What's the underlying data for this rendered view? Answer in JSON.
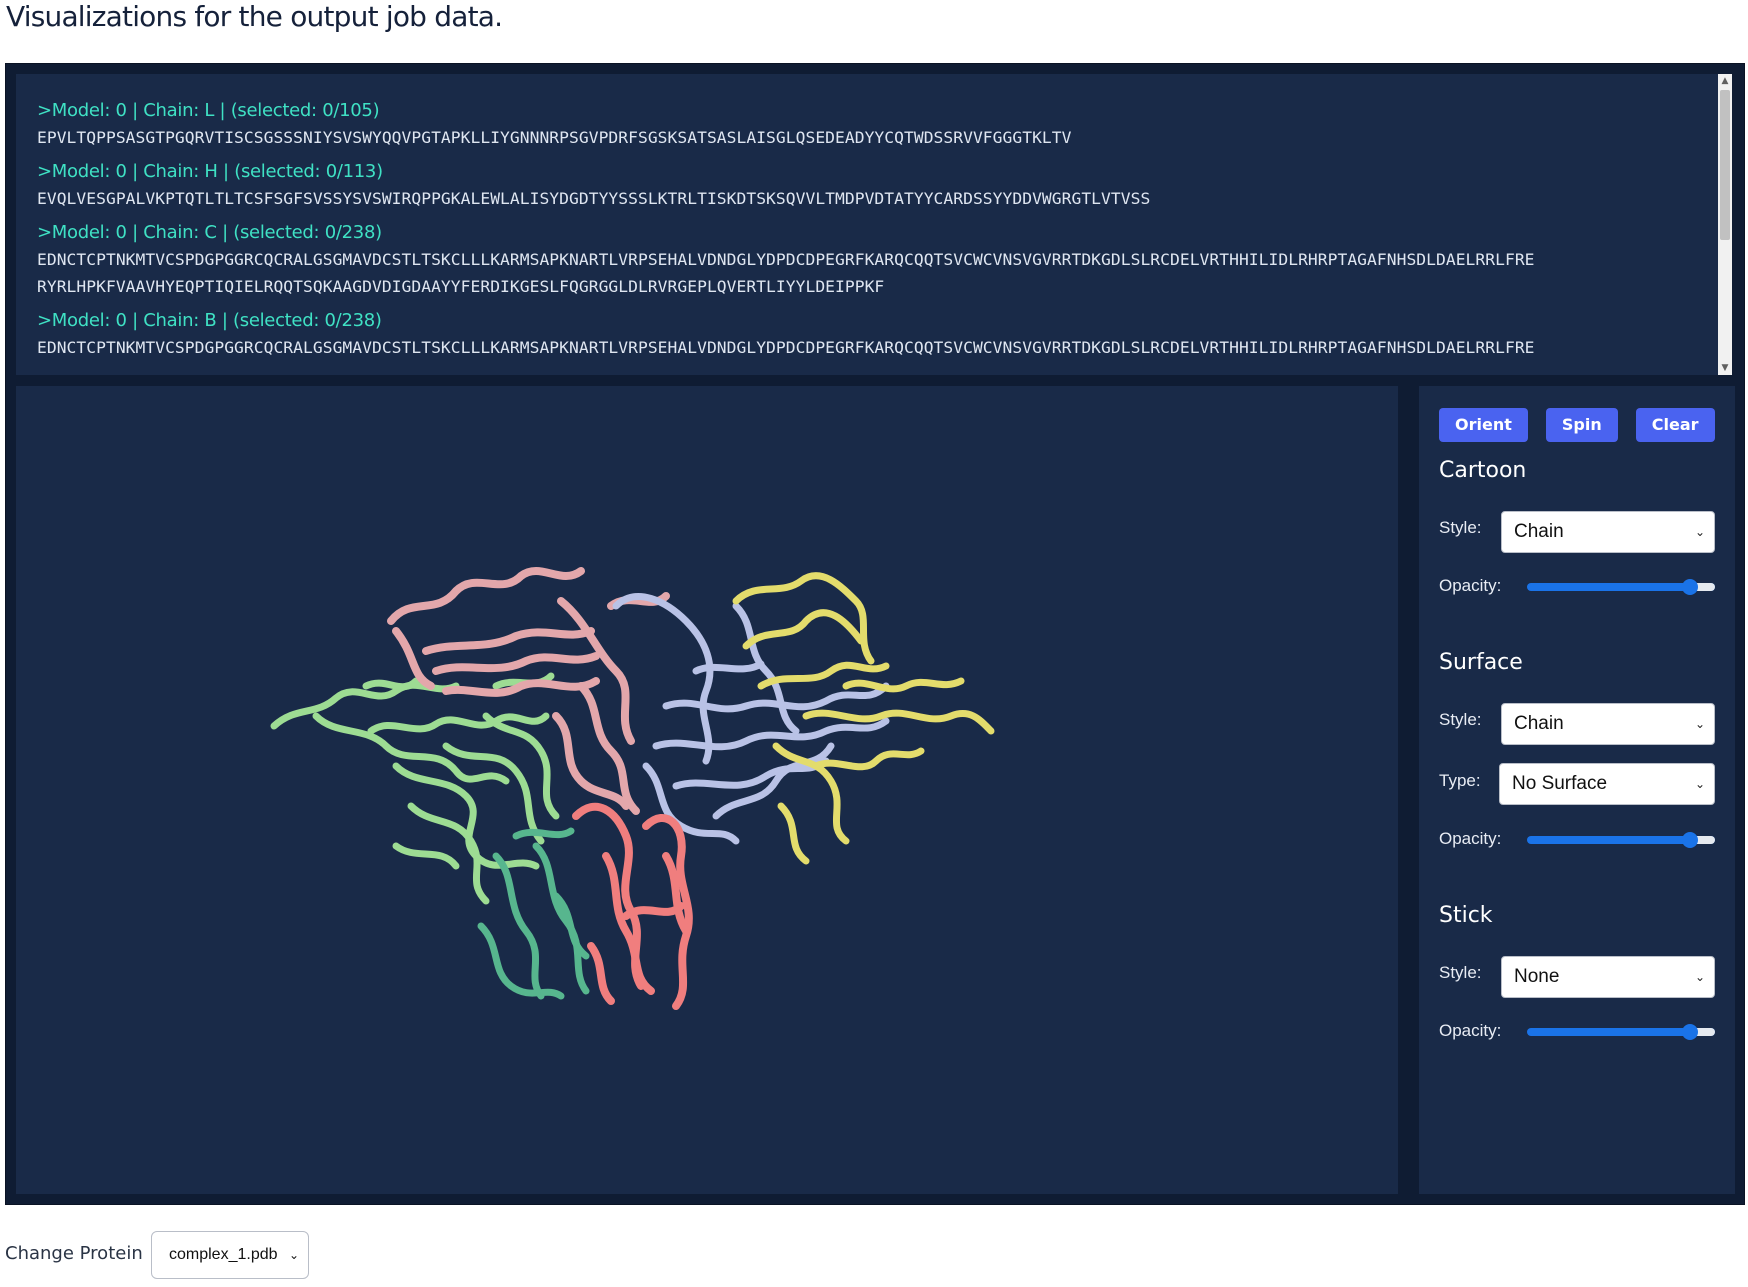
{
  "page": {
    "title": "Visualizations for the output job data."
  },
  "sequences": [
    {
      "header": ">Model: 0 | Chain: L | (selected: 0/105)",
      "lines": [
        "EPVLTQPPSASGTPGQRVTISCSGSSSNIYSVSWYQQVPGTAPKLLIYGNNNRPSGVPDRFSGSKSATSASLAISGLQSEDEADYYCQTWDSSRVVFGGGTKLTV"
      ]
    },
    {
      "header": ">Model: 0 | Chain: H | (selected: 0/113)",
      "lines": [
        "EVQLVESGPALVKPTQTLTLTCSFSGFSVSSYSVSWIRQPPGKALEWLALISYDGDTYYSSSLKTRLTISKDTSKSQVVLTMDPVDTATYYCARDSSYYDDVWGRGTLVTVSS"
      ]
    },
    {
      "header": ">Model: 0 | Chain: C | (selected: 0/238)",
      "lines": [
        "EDNCTCPTNKMTVCSPDGPGGRCQCRALGSGMAVDCSTLTSKCLLLKARMSAPKNARTLVRPSEHALVDNDGLYDPDCDPEGRFKARQCQQTSVCWCVNSVGVRRTDKGDLSLRCDELVRTHHILIDLRHRPTAGAFNHSDLDAELRRLFRE",
        "RYRLHPKFVAAVHYEQPTIQIELRQQTSQKAAGDVDIGDAAYYFERDIKGESLFQGRGGLDLRVRGEPLQVERTLIYYLDEIPPKF"
      ]
    },
    {
      "header": ">Model: 0 | Chain: B | (selected: 0/238)",
      "lines": [
        "EDNCTCPTNKMTVCSPDGPGGRCQCRALGSGMAVDCSTLTSKCLLLKARMSAPKNARTLVRPSEHALVDNDGLYDPDCDPEGRFKARQCQQTSVCWCVNSVGVRRTDKGDLSLRCDELVRTHHILIDLRHRPTAGAFNHSDLDAELRRLFRE"
      ]
    }
  ],
  "controls": {
    "buttons": {
      "orient": "Orient",
      "spin": "Spin",
      "clear": "Clear"
    },
    "cartoon": {
      "title": "Cartoon",
      "style_label": "Style:",
      "style_value": "Chain",
      "opacity_label": "Opacity:",
      "opacity": 0.9
    },
    "surface": {
      "title": "Surface",
      "style_label": "Style:",
      "style_value": "Chain",
      "type_label": "Type:",
      "type_value": "No Surface",
      "opacity_label": "Opacity:",
      "opacity": 0.9
    },
    "stick": {
      "title": "Stick",
      "style_label": "Style:",
      "style_value": "None",
      "opacity_label": "Opacity:",
      "opacity": 0.9
    }
  },
  "footer": {
    "change_protein_label": "Change Protein",
    "protein_value": "complex_1.pdb"
  },
  "colors": {
    "chain_L": "#e3a7ab",
    "chain_H": "#f07e7e",
    "chain_C": "#b9c2e6",
    "chain_B": "#e3dc6c",
    "chain_A": "#9ddc93",
    "chain_D": "#57b68e",
    "accent": "#4a63f0",
    "panel_bg": "#192a48"
  }
}
